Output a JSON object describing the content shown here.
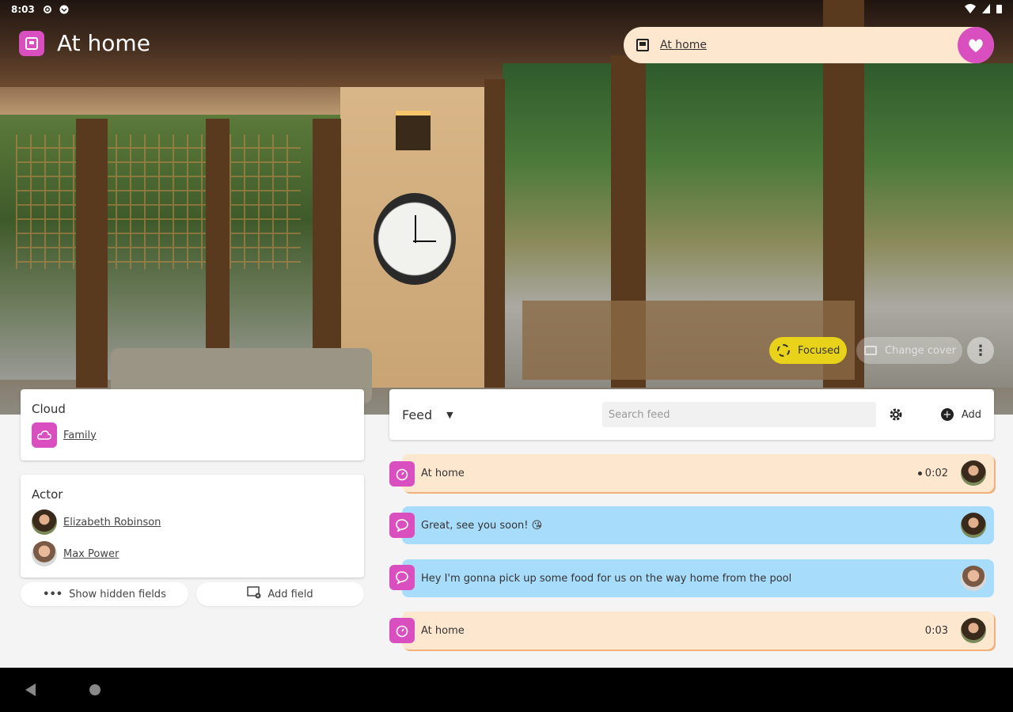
{
  "status_bar": {
    "time": "8:03"
  },
  "header": {
    "title": "At home"
  },
  "top_pill": {
    "label": "At home"
  },
  "chips": {
    "focused": "Focused",
    "change_cover": "Change cover"
  },
  "cloud_card": {
    "title": "Cloud",
    "value": "Family"
  },
  "actor_card": {
    "title": "Actor",
    "actors": [
      {
        "name": "Elizabeth Robinson"
      },
      {
        "name": "Max Power"
      }
    ]
  },
  "buttons": {
    "show_hidden": "Show hidden fields",
    "add_field": "Add field"
  },
  "feed": {
    "title": "Feed",
    "search_placeholder": "Search feed",
    "add_label": "Add",
    "items": [
      {
        "type": "location",
        "text": "At home",
        "time": "0:02"
      },
      {
        "type": "message",
        "text": "Great, see you soon! 😘"
      },
      {
        "type": "message",
        "text": "Hey I'm gonna pick up some food for us on the way home from the pool"
      },
      {
        "type": "location",
        "text": "At home",
        "time": "0:03"
      }
    ]
  },
  "colors": {
    "accent": "#d94fc0",
    "location_bg": "#fde7cf",
    "message_bg": "#a8dcfb",
    "focused_chip": "#e8d21a"
  }
}
